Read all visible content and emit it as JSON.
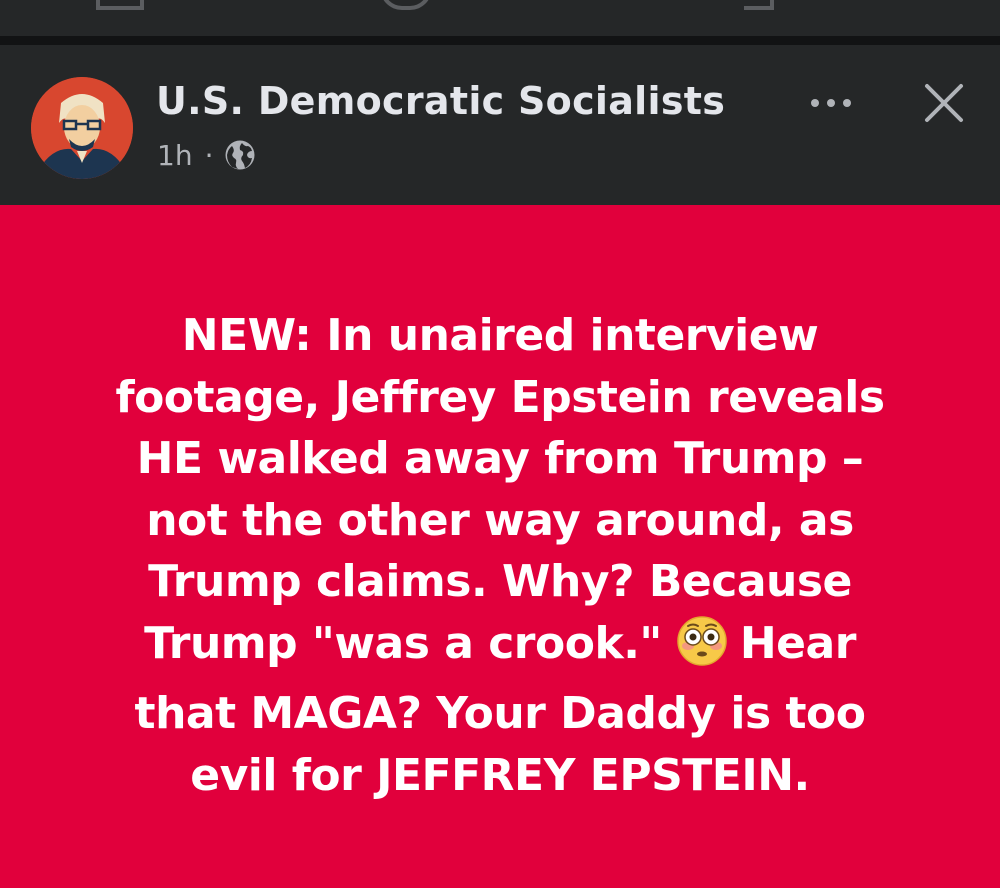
{
  "post": {
    "author": "U.S. Democratic Socialists",
    "timestamp": "1h",
    "separator": "·",
    "privacy_icon": "globe-icon",
    "more_icon": "more-horizontal-icon",
    "close_icon": "close-icon",
    "avatar_icon": "avatar-portrait",
    "background_color": "#e1003c",
    "text_lines": [
      "NEW: In unaired interview",
      "footage, Jeffrey Epstein reveals",
      "HE walked away from Trump –",
      "not the other way around, as",
      "Trump claims. Why? Because",
      "Trump \"was a crook.\"",
      "Hear",
      "that MAGA? Your Daddy is too",
      "evil for JEFFREY EPSTEIN."
    ],
    "emoji_icon": "flushed-face-emoji"
  }
}
